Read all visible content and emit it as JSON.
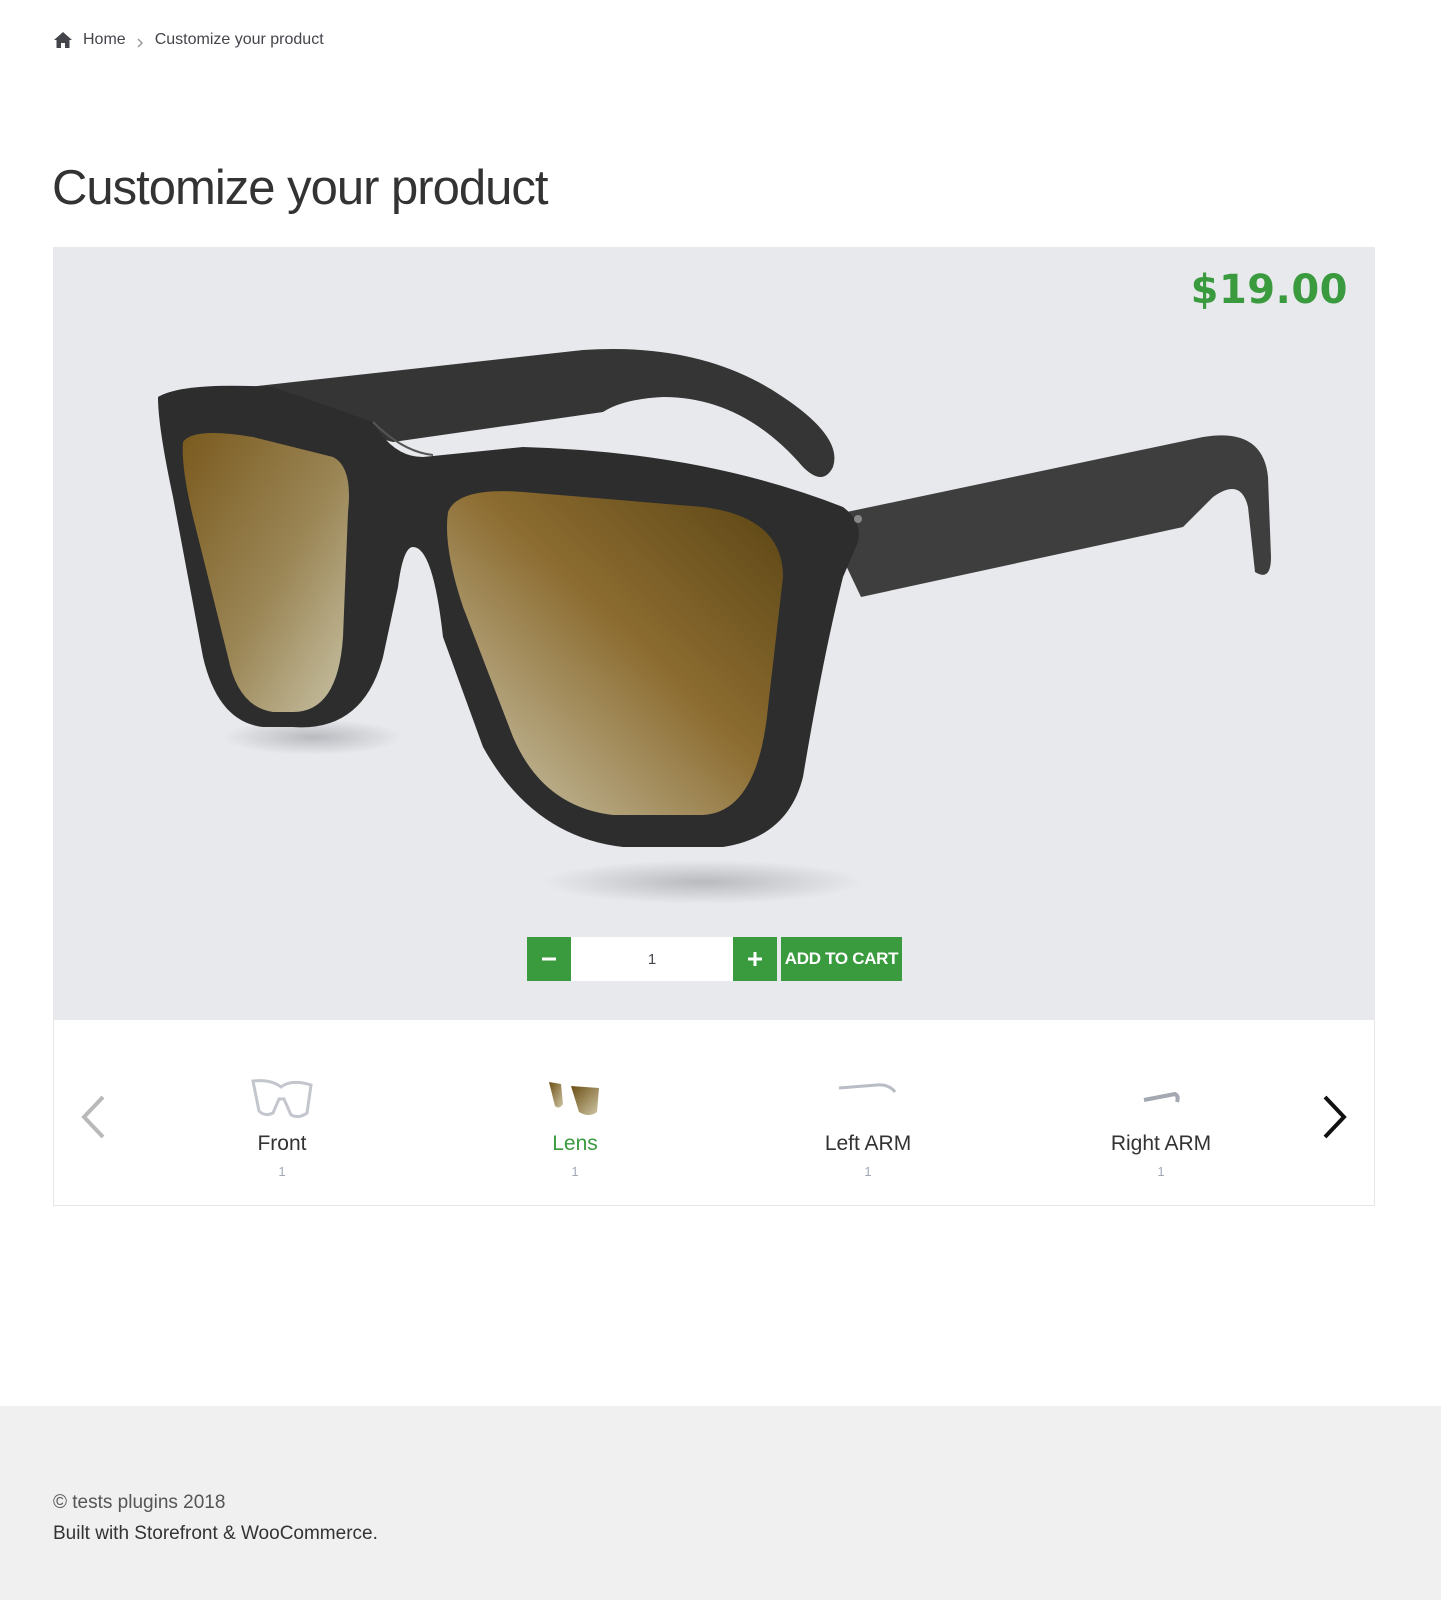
{
  "breadcrumb": {
    "home_label": "Home",
    "current_label": "Customize your product",
    "icon": "home-icon"
  },
  "page": {
    "title": "Customize your product"
  },
  "product": {
    "price": "$19.00",
    "image_icon": "sunglasses-image"
  },
  "cart": {
    "quantity": "1",
    "decrease_icon": "minus-icon",
    "increase_icon": "plus-icon",
    "add_label": "ADD TO CART"
  },
  "options": {
    "items": [
      {
        "label": "Front",
        "count": "1",
        "icon": "frame-front-icon",
        "active": false
      },
      {
        "label": "Lens",
        "count": "1",
        "icon": "lens-icon",
        "active": true
      },
      {
        "label": "Left ARM",
        "count": "1",
        "icon": "left-arm-icon",
        "active": false
      },
      {
        "label": "Right ARM",
        "count": "1",
        "icon": "right-arm-icon",
        "active": false
      }
    ],
    "prev_icon": "chevron-left-icon",
    "next_icon": "chevron-right-icon"
  },
  "footer": {
    "copyright": "© tests plugins 2018",
    "built_with": "Built with Storefront & WooCommerce."
  },
  "colors": {
    "accent": "#3a9a3e",
    "stage_bg": "#e8e9ed",
    "footer_bg": "#f0f0f0"
  }
}
